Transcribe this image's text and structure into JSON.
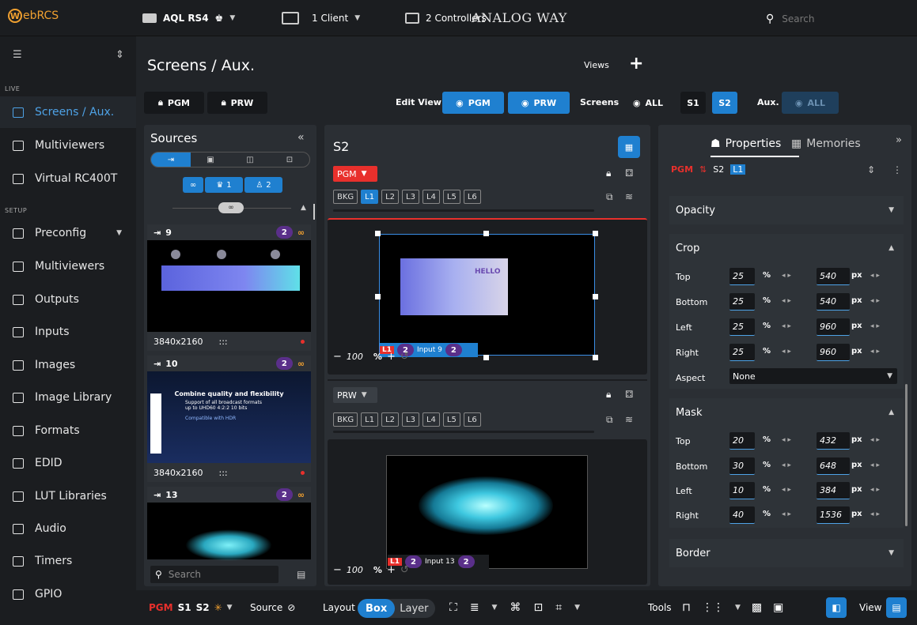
{
  "app": {
    "name_w": "W",
    "name_rest": "ebRCS"
  },
  "topbar": {
    "device": "AQL RS4",
    "device_extra": "♚",
    "clients": "1 Client",
    "controllers": "2 Controllers",
    "brand": "ANALOG WAY",
    "search_placeholder": "Search"
  },
  "sidebar": {
    "section_live": "LIVE",
    "section_setup": "SETUP",
    "items": [
      {
        "label": "Screens / Aux.",
        "icon": "screens-icon"
      },
      {
        "label": "Multiviewers",
        "icon": "multiviewers-icon"
      },
      {
        "label": "Virtual RC400T",
        "icon": "keyboard-icon"
      },
      {
        "label": "Preconfig",
        "icon": "preconfig-icon"
      },
      {
        "label": "Multiviewers",
        "icon": "multiviewers-setup-icon"
      },
      {
        "label": "Outputs",
        "icon": "outputs-icon"
      },
      {
        "label": "Inputs",
        "icon": "inputs-icon"
      },
      {
        "label": "Images",
        "icon": "images-icon"
      },
      {
        "label": "Image Library",
        "icon": "image-library-icon"
      },
      {
        "label": "Formats",
        "icon": "formats-icon"
      },
      {
        "label": "EDID",
        "icon": "edid-icon"
      },
      {
        "label": "LUT Libraries",
        "icon": "lut-icon"
      },
      {
        "label": "Audio",
        "icon": "audio-icon"
      },
      {
        "label": "Timers",
        "icon": "timers-icon"
      },
      {
        "label": "GPIO",
        "icon": "gpio-icon"
      }
    ]
  },
  "header": {
    "title": "Screens / Aux.",
    "views": "Views",
    "pgm": "PGM",
    "prw": "PRW",
    "edit_view": "Edit View",
    "edit_pgm": "PGM",
    "edit_prw": "PRW",
    "screens": "Screens",
    "all": "ALL",
    "s1": "S1",
    "s2": "S2",
    "aux": "Aux.",
    "aux_all": "ALL"
  },
  "sources": {
    "title": "Sources",
    "filter1": "1",
    "filter2": "2",
    "tiles": [
      {
        "num": "9",
        "badge": "2",
        "res": "3840x2160",
        "dots": ":::"
      },
      {
        "num": "10",
        "badge": "2",
        "res": "3840x2160",
        "dots": ":::",
        "slide_title": "Combine quality and flexibility",
        "slide_l1": "Support of all broadcast formats",
        "slide_l2": "up to UHD60 4:2:2 10 bits",
        "slide_l3": "Compatible with HDR"
      },
      {
        "num": "13",
        "badge": "2"
      }
    ],
    "search_placeholder": "Search"
  },
  "screen": {
    "title": "S2",
    "pgm_label": "PGM",
    "prw_label": "PRW",
    "layers": [
      "BKG",
      "L1",
      "L2",
      "L3",
      "L4",
      "L5",
      "L6"
    ],
    "pgm_layer_tag": "L1",
    "pgm_layer_badge": "2",
    "pgm_input": "Input 9",
    "pgm_input_badge": "2",
    "prw_layer_tag": "L1",
    "prw_layer_badge": "2",
    "prw_input": "Input 13",
    "prw_input_badge": "2",
    "zoom_pgm": "100",
    "zoom_prw": "100",
    "pct": "%",
    "minus": "−",
    "plus": "+",
    "hello": "HELLO"
  },
  "properties": {
    "tab_properties": "Properties",
    "tab_memories": "Memories",
    "state": "PGM",
    "screen": "S2",
    "layer": "L1",
    "opacity": "Opacity",
    "crop": {
      "title": "Crop",
      "rows": [
        {
          "label": "Top",
          "pct": "25",
          "px": "540"
        },
        {
          "label": "Bottom",
          "pct": "25",
          "px": "540"
        },
        {
          "label": "Left",
          "pct": "25",
          "px": "960"
        },
        {
          "label": "Right",
          "pct": "25",
          "px": "960"
        }
      ],
      "aspect_label": "Aspect",
      "aspect_value": "None"
    },
    "mask": {
      "title": "Mask",
      "rows": [
        {
          "label": "Top",
          "pct": "20",
          "px": "432"
        },
        {
          "label": "Bottom",
          "pct": "30",
          "px": "648"
        },
        {
          "label": "Left",
          "pct": "10",
          "px": "384"
        },
        {
          "label": "Right",
          "pct": "40",
          "px": "1536"
        }
      ]
    },
    "border": "Border",
    "unit_pct": "%",
    "unit_px": "px"
  },
  "bottombar": {
    "pgm": "PGM",
    "s1": "S1",
    "s2": "S2",
    "source": "Source",
    "layout": "Layout",
    "box": "Box",
    "layer": "Layer",
    "tools": "Tools",
    "view": "View"
  },
  "colors": {
    "accent": "#1f80d0",
    "red": "#e8302c",
    "purple": "#5a2f8a",
    "orange": "#f0a030",
    "selection": "#3a8ee6"
  }
}
